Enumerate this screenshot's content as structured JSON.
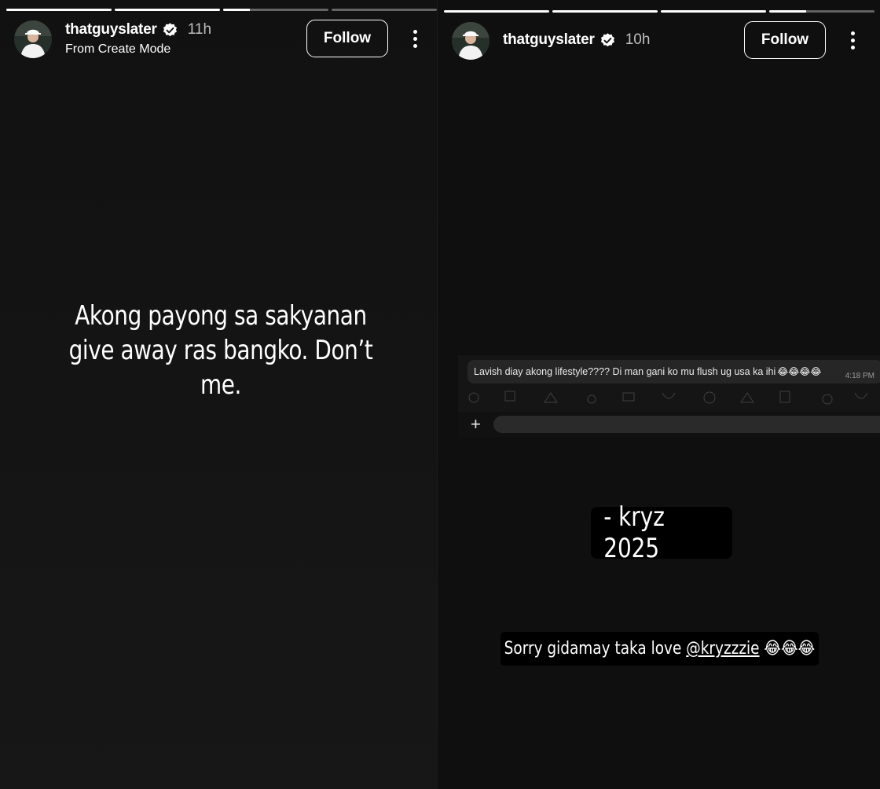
{
  "stories": [
    {
      "progress": [
        1,
        1,
        0.25,
        0
      ],
      "header": {
        "username": "thatguyslater",
        "verified_icon": "verified-badge-icon",
        "age": "11h",
        "subtitle": "From Create Mode",
        "follow_label": "Follow",
        "more_icon": "more-vertical-icon"
      },
      "text": "Akong payong sa sakyanan give away ras bangko. Don’t me."
    },
    {
      "progress": [
        1,
        1,
        1,
        0.35
      ],
      "header": {
        "username": "thatguyslater",
        "verified_icon": "verified-badge-icon",
        "age": "10h",
        "follow_label": "Follow",
        "more_icon": "more-vertical-icon"
      },
      "chat": {
        "message": "Lavish diay akong lifestyle???? Di man gani ko mu flush ug usa ka ihi",
        "emoji": "😂😂😂😂",
        "time": "4:18 PM",
        "plus_icon": "plus-icon"
      },
      "signature": "- kryz 2025",
      "reply": {
        "text": "Sorry gidamay taka love ",
        "mention": "@kryzzzie",
        "emoji": " 😂😂😂"
      }
    }
  ],
  "colors": {
    "background": "#111111",
    "text": "#ffffff",
    "muted": "#bdbdbd",
    "progress_track": "rgba(255,255,255,0.35)"
  }
}
